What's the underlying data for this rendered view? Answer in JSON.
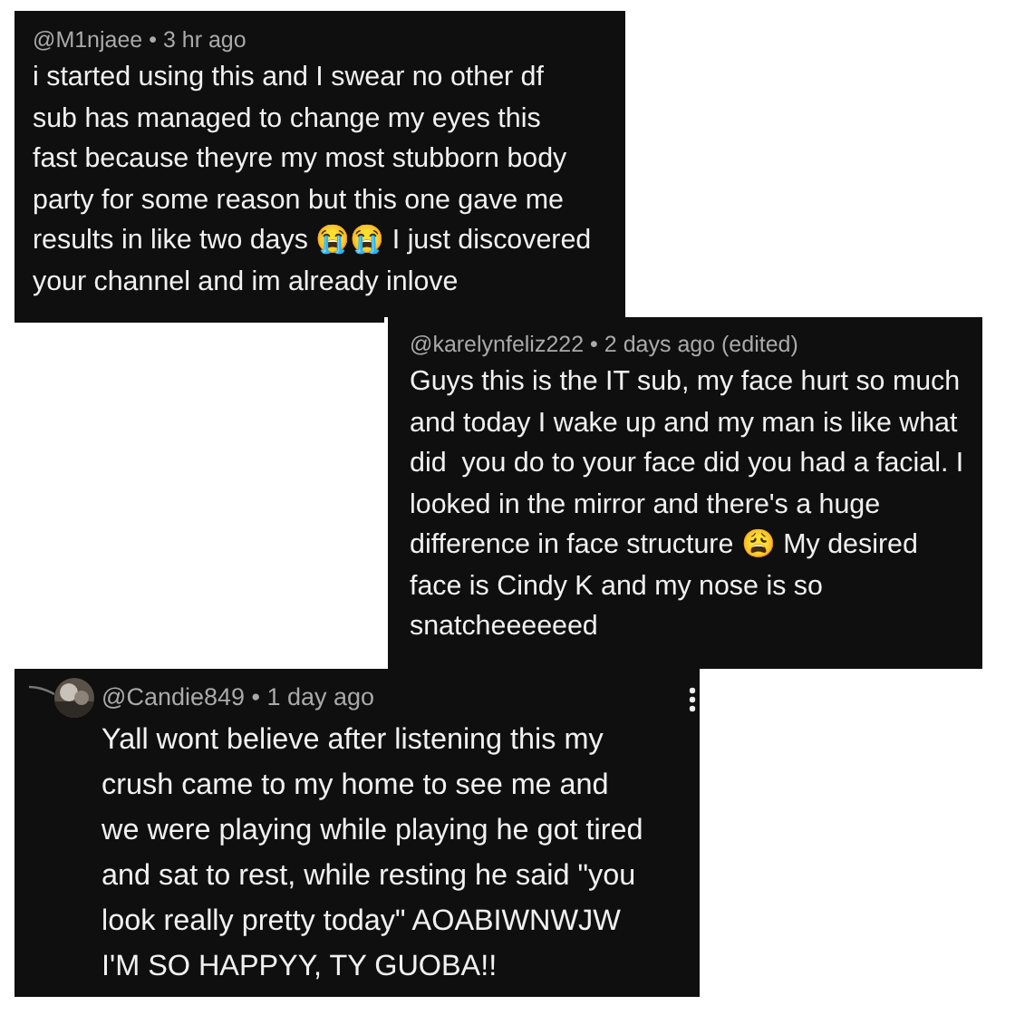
{
  "comments": [
    {
      "header": "@M1njaee • 3 hr ago",
      "avatar": false,
      "menu": false,
      "text": "i started using this and I swear no other df\nsub has managed to change my eyes this\nfast because theyre my most stubborn body\nparty for some reason but this one gave me\nresults in like two days 😭😭 I just discovered\nyour channel and im already inlove"
    },
    {
      "header": "@karelynfeliz222 • 2 days ago (edited)",
      "avatar": false,
      "menu": false,
      "text": "Guys this is the IT sub, my face hurt so much\nand today I wake up and my man is like what\ndid  you do to your face did you had a facial. I\nlooked in the mirror and there's a huge\ndifference in face structure 😩 My desired\nface is Cindy K and my nose is so\nsnatcheeeeeed"
    },
    {
      "header": "@Candie849 • 1 day ago",
      "avatar": true,
      "menu": true,
      "text": "Yall wont believe after listening this my\ncrush came to my home to see me and\nwe were playing while playing he got tired\nand sat to rest, while resting he said \"you\nlook really pretty today\" AOABIWNWJW\nI'M SO HAPPYY, TY GUOBA!!"
    }
  ]
}
